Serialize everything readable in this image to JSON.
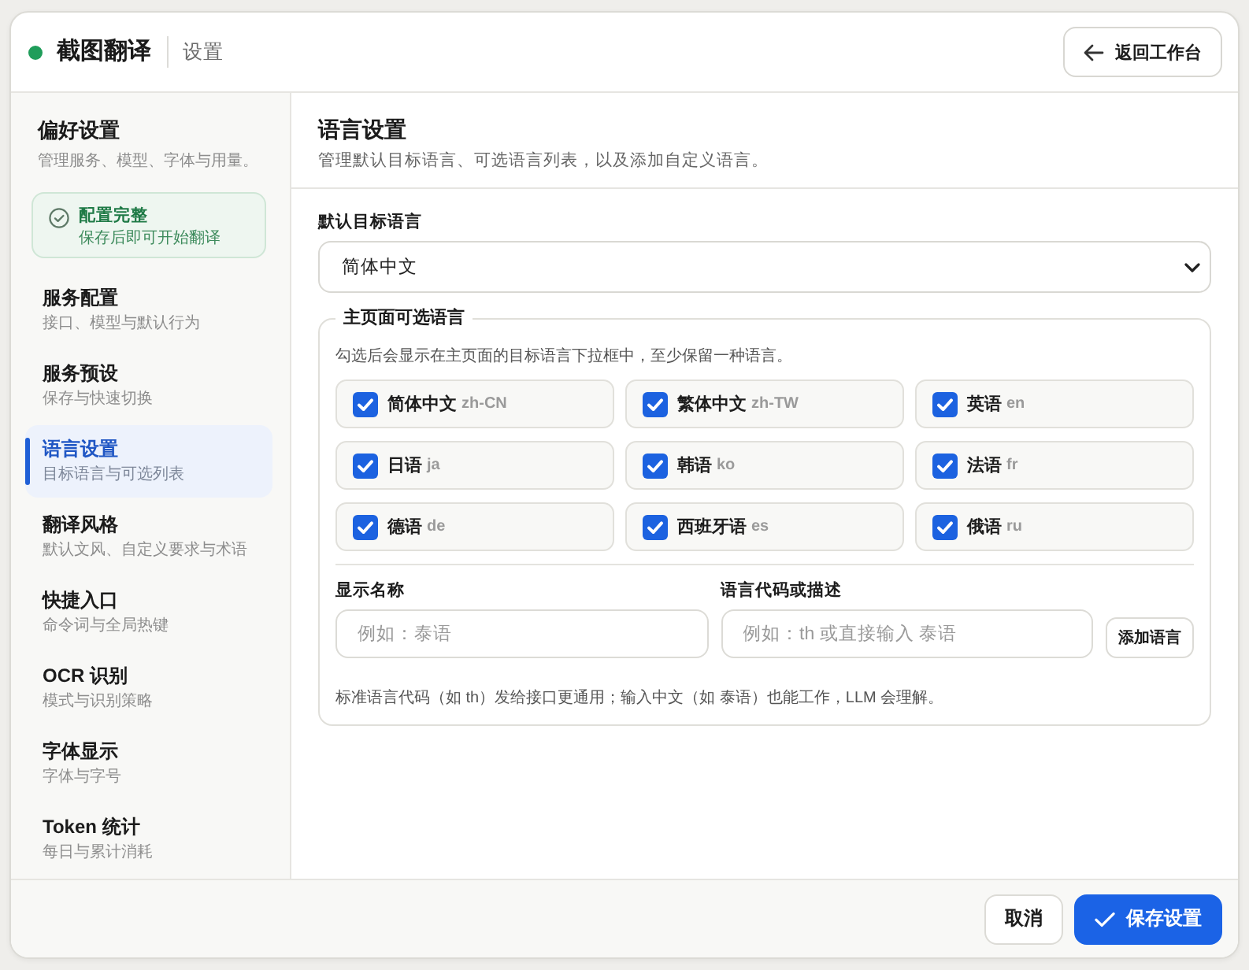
{
  "header": {
    "title": "截图翻译",
    "page": "设置",
    "back_button": "返回工作台"
  },
  "sidebar": {
    "title": "偏好设置",
    "description": "管理服务、模型、字体与用量。",
    "status_card": {
      "title": "配置完整",
      "text": "保存后即可开始翻译"
    },
    "items": [
      {
        "label": "服务配置",
        "description": "接口、模型与默认行为",
        "selected": false
      },
      {
        "label": "服务预设",
        "description": "保存与快速切换",
        "selected": false
      },
      {
        "label": "语言设置",
        "description": "目标语言与可选列表",
        "selected": true
      },
      {
        "label": "翻译风格",
        "description": "默认文风、自定义要求与术语",
        "selected": false
      },
      {
        "label": "快捷入口",
        "description": "命令词与全局热键",
        "selected": false
      },
      {
        "label": "OCR 识别",
        "description": "模式与识别策略",
        "selected": false
      },
      {
        "label": "字体显示",
        "description": "字体与字号",
        "selected": false
      },
      {
        "label": "Token 统计",
        "description": "每日与累计消耗",
        "selected": false
      }
    ]
  },
  "panel": {
    "title": "语言设置",
    "description": "管理默认目标语言、可选语言列表，以及添加自定义语言。",
    "default_language": {
      "label": "默认目标语言",
      "value": "简体中文"
    },
    "available_languages": {
      "legend": "主页面可选语言",
      "hint": "勾选后会显示在主页面的目标语言下拉框中，至少保留一种语言。",
      "options": [
        {
          "name": "简体中文",
          "code": "zh-CN",
          "checked": true
        },
        {
          "name": "繁体中文",
          "code": "zh-TW",
          "checked": true
        },
        {
          "name": "英语",
          "code": "en",
          "checked": true
        },
        {
          "name": "日语",
          "code": "ja",
          "checked": true
        },
        {
          "name": "韩语",
          "code": "ko",
          "checked": true
        },
        {
          "name": "法语",
          "code": "fr",
          "checked": true
        },
        {
          "name": "德语",
          "code": "de",
          "checked": true
        },
        {
          "name": "西班牙语",
          "code": "es",
          "checked": true
        },
        {
          "name": "俄语",
          "code": "ru",
          "checked": true
        }
      ],
      "custom_language": {
        "name_field": {
          "label": "显示名称",
          "placeholder": "例如：泰语"
        },
        "code_field": {
          "label": "语言代码或描述",
          "placeholder": "例如：th 或直接输入 泰语"
        },
        "add_button": "添加语言",
        "note": "标准语言代码（如 th）发给接口更通用；输入中文（如 泰语）也能工作，LLM 会理解。"
      }
    }
  },
  "footer": {
    "buttons": [
      {
        "label": "取消",
        "kind": "secondary"
      },
      {
        "label": "保存设置",
        "kind": "primary"
      }
    ]
  }
}
